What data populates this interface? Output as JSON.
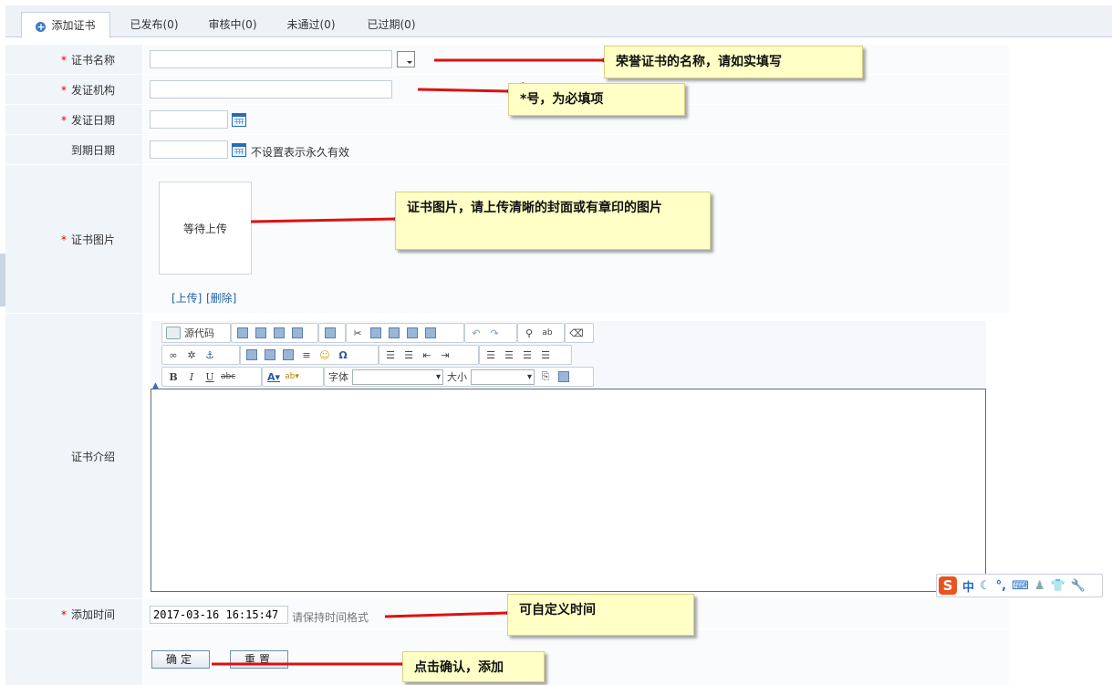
{
  "tabs": [
    {
      "label": "添加证书",
      "active": true
    },
    {
      "label": "已发布(0)"
    },
    {
      "label": "审核中(0)"
    },
    {
      "label": "未通过(0)"
    },
    {
      "label": "已过期(0)"
    }
  ],
  "form": {
    "required_mark": "*",
    "name_label": "证书名称",
    "issuer_label": "发证机构",
    "issue_date_label": "发证日期",
    "expire_date_label": "到期日期",
    "expire_hint": "不设置表示永久有效",
    "image_label": "证书图片",
    "image_placeholder": "等待上传",
    "upload_link": "[上传]",
    "delete_link": "[删除]",
    "intro_label": "证书介绍",
    "add_time_label": "添加时间",
    "add_time_value": "2017-03-16 16:15:47",
    "add_time_hint": "请保持时间格式",
    "confirm_button": "确定",
    "reset_button": "重置"
  },
  "editor": {
    "source_label": "源代码",
    "font_label": "字体",
    "size_label": "大小"
  },
  "callouts": {
    "name": "荣誉证书的名称，请如实填写",
    "required": "*号，为必填项",
    "image": "证书图片，请上传清晰的封面或有章印的图片",
    "time": "可自定义时间",
    "confirm": "点击确认，添加"
  },
  "ime": {
    "logo": "S",
    "mode": "中"
  },
  "colors": {
    "label_bg": "#f0f5f9",
    "required": "#dd0000",
    "callout_bg": "#ffffc6",
    "arrow": "#dd1111",
    "link": "#2463a7"
  }
}
